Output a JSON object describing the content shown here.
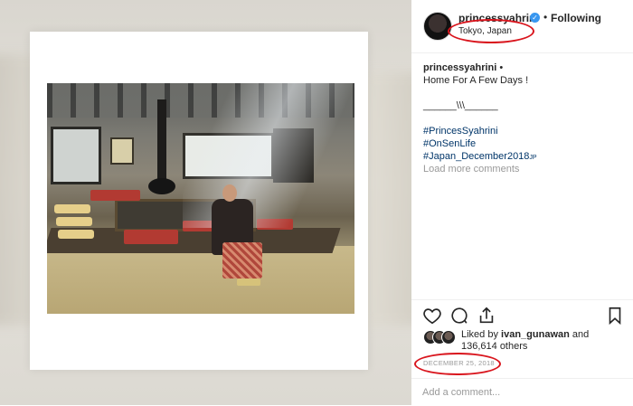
{
  "post": {
    "username": "princessyahrini",
    "verified_mark": "✓",
    "separator": "•",
    "follow_status": "Following",
    "location": "Tokyo, Japan"
  },
  "caption": {
    "username": "princessyahrini",
    "separator": "•",
    "line1": "Home For A Few Days !",
    "line2": "______\\\\\\______",
    "tags": [
      "#PrincesSyahrini",
      "#OnSenLife",
      "#Japan_December2018"
    ],
    "tag_suffix": "JP",
    "load_more": "Load more comments"
  },
  "likes": {
    "prefix": "Liked by",
    "user": "ivan_gunawan",
    "conjunction": "and",
    "count": "136,614 others"
  },
  "date": "DECEMBER 25, 2018",
  "comment": {
    "placeholder": "Add a comment..."
  },
  "icons": {
    "like": "heart-icon",
    "comment": "comment-icon",
    "share": "share-icon",
    "save": "bookmark-icon"
  },
  "colors": {
    "annotation_circle": "#d9151d",
    "hashtag": "#003569",
    "verified": "#3897f0",
    "muted_text": "#999999"
  }
}
